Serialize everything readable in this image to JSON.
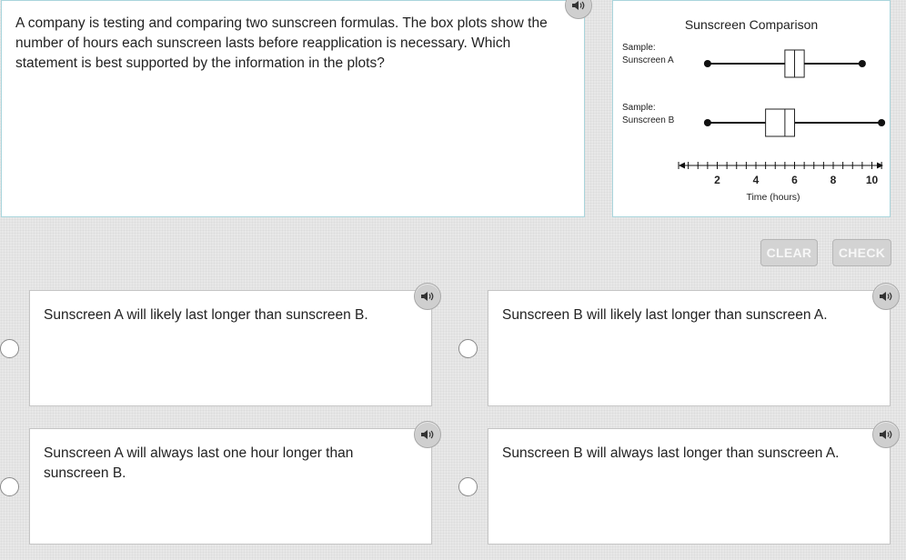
{
  "question": {
    "text": "A company is testing and comparing two sunscreen formulas. The box plots show the number of hours each sunscreen lasts before reapplication is necessary. Which statement is best supported by the information in the plots?"
  },
  "chart_data": {
    "type": "boxplot",
    "title": "Sunscreen Comparison",
    "xlabel": "Time (hours)",
    "xlim": [
      0,
      10
    ],
    "ticks": [
      1,
      2,
      3,
      4,
      5,
      6,
      7,
      8,
      9,
      10
    ],
    "tick_labels": [
      "2",
      "4",
      "6",
      "8",
      "10"
    ],
    "tick_label_values": [
      2,
      4,
      6,
      8,
      10
    ],
    "series": [
      {
        "label_line1": "Sample:",
        "label_line2": "Sunscreen A",
        "min": 1.5,
        "q1": 5.5,
        "median": 6,
        "q3": 6.5,
        "max": 9.5
      },
      {
        "label_line1": "Sample:",
        "label_line2": "Sunscreen B",
        "min": 1.5,
        "q1": 4.5,
        "median": 5.5,
        "q3": 6,
        "max": 10.5
      }
    ]
  },
  "buttons": {
    "clear": "CLEAR",
    "check": "CHECK"
  },
  "choices": [
    {
      "text": "Sunscreen A will likely last longer than sunscreen B."
    },
    {
      "text": "Sunscreen B will likely last longer than sunscreen A."
    },
    {
      "text": "Sunscreen A will always last one hour longer than sunscreen B."
    },
    {
      "text": "Sunscreen B will always last longer than sunscreen A."
    }
  ],
  "icons": {
    "audio": "speaker-icon"
  }
}
